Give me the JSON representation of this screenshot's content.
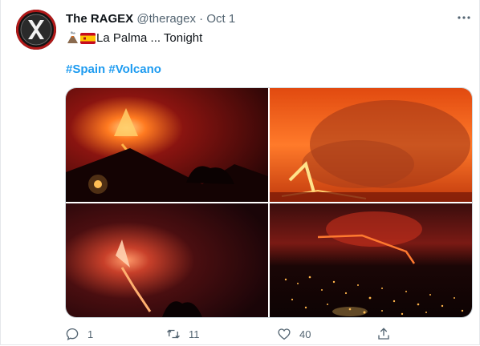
{
  "tweet": {
    "author_name": "The RAGEX",
    "handle": "@theragex",
    "separator": "·",
    "date": "Oct 1",
    "more_label": "···",
    "text": "La Palma ... Tonight",
    "hashtags": [
      "#Spain",
      "#Volcano"
    ]
  },
  "media": {
    "images": [
      {
        "subject": "volcano-eruption-night"
      },
      {
        "subject": "volcano-smoke-plume-orange"
      },
      {
        "subject": "volcano-eruption-night-dim"
      },
      {
        "subject": "volcano-over-city-lights"
      }
    ]
  },
  "actions": {
    "reply_count": "1",
    "retweet_count": "11",
    "like_count": "40",
    "share_label": ""
  },
  "colors": {
    "accent": "#1d9bf0",
    "muted": "#536471",
    "text": "#0f1419"
  }
}
